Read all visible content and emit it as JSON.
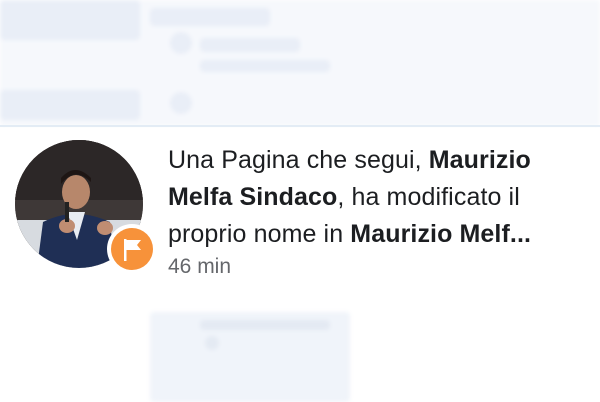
{
  "notification": {
    "prefix": "Una Pagina che segui, ",
    "page_old_name": "Maurizio Melfa Sindaco",
    "middle": ", ha modificato il proprio nome in ",
    "page_new_name": "Maurizio Melf...",
    "time": "46 min",
    "avatar_icon": "person-photo",
    "badge_icon": "flag-icon",
    "badge_color": "#f7923a"
  },
  "colors": {
    "text": "#1c1e21",
    "muted": "#65676b",
    "divider": "#e3ecf5"
  }
}
